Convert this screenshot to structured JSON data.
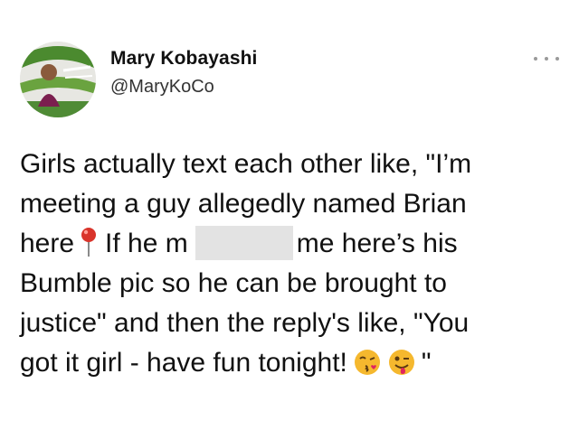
{
  "author": {
    "display_name": "Mary Kobayashi",
    "handle": "@MaryKoCo",
    "avatar_icon": "avatar-icon"
  },
  "menu": {
    "icon": "more-icon"
  },
  "tweet": {
    "line1": "Girls actually text each other like, \"I’m",
    "line2": "meeting a guy allegedly named Brian",
    "line3_a": "here",
    "line3_b": "If he m",
    "line3_c": "me here’s his",
    "line4": "Bumble pic so he can be brought to",
    "line5": "justice\" and then the reply's like, \"You",
    "line6_a": "got it girl - have fun tonight!",
    "line6_b": "\""
  },
  "icons": {
    "pin": "pin-icon",
    "kiss": "kissing-face-icon",
    "wink": "winking-tongue-face-icon"
  },
  "colors": {
    "pin": "#d9342b",
    "emoji_face": "#f5b82e",
    "heart": "#e0245e"
  }
}
